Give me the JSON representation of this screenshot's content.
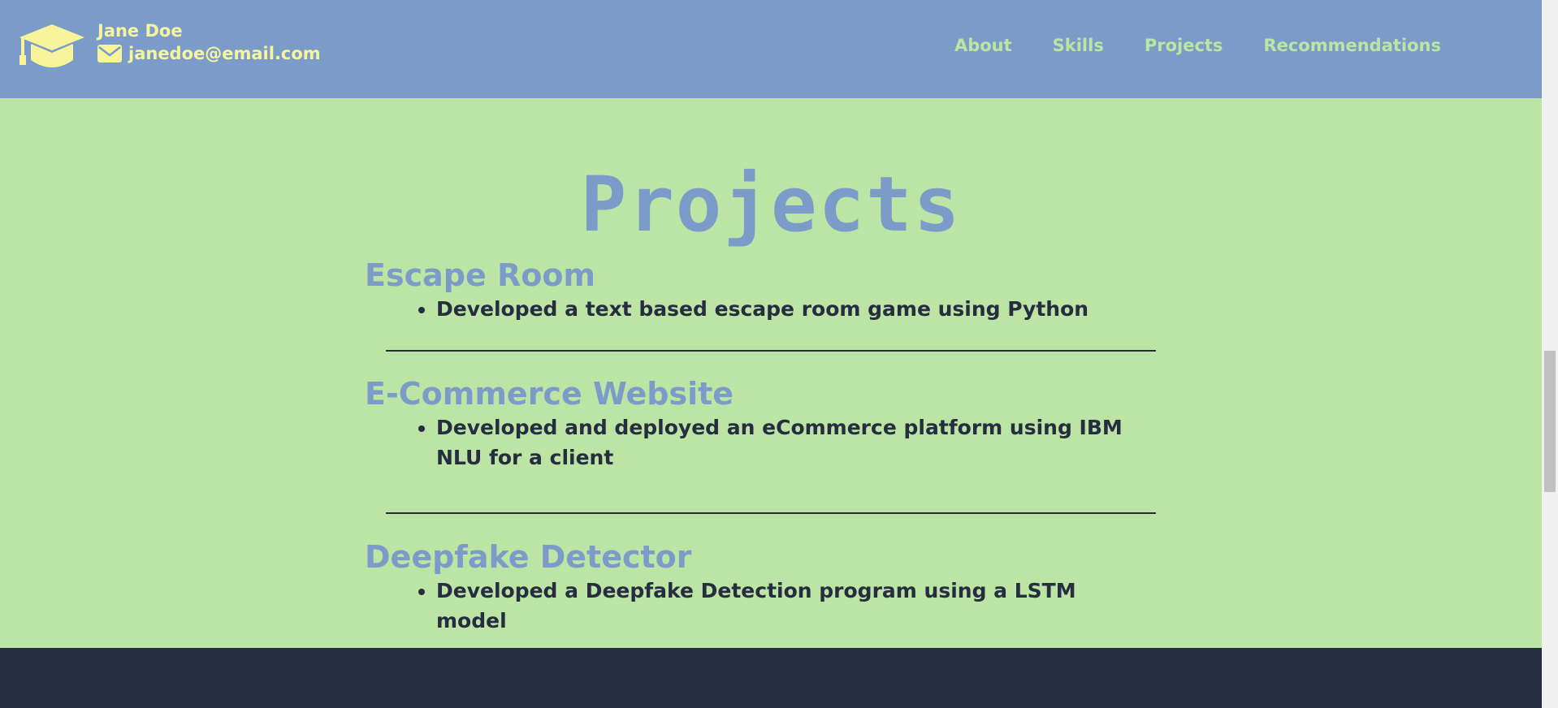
{
  "header": {
    "logo_icon": "graduation-cap-icon",
    "name": "Jane Doe",
    "email_icon": "envelope-icon",
    "email": "janedoe@email.com",
    "nav": [
      "About",
      "Skills",
      "Projects",
      "Recommendations"
    ]
  },
  "projects": {
    "title": "Projects",
    "items": [
      {
        "title": "Escape Room",
        "bullets": [
          "Developed a text based escape room game using Python"
        ]
      },
      {
        "title": "E-Commerce Website",
        "bullets": [
          "Developed and deployed an eCommerce platform using IBM NLU for a client"
        ]
      },
      {
        "title": "Deepfake Detector",
        "bullets": [
          "Developed a Deepfake Detection program using a LSTM model"
        ]
      }
    ]
  },
  "colors": {
    "header_bg": "#7b9cc8",
    "page_bg": "#bce4a4",
    "accent_yellow": "#f8f49c",
    "text_dark": "#262d40"
  }
}
